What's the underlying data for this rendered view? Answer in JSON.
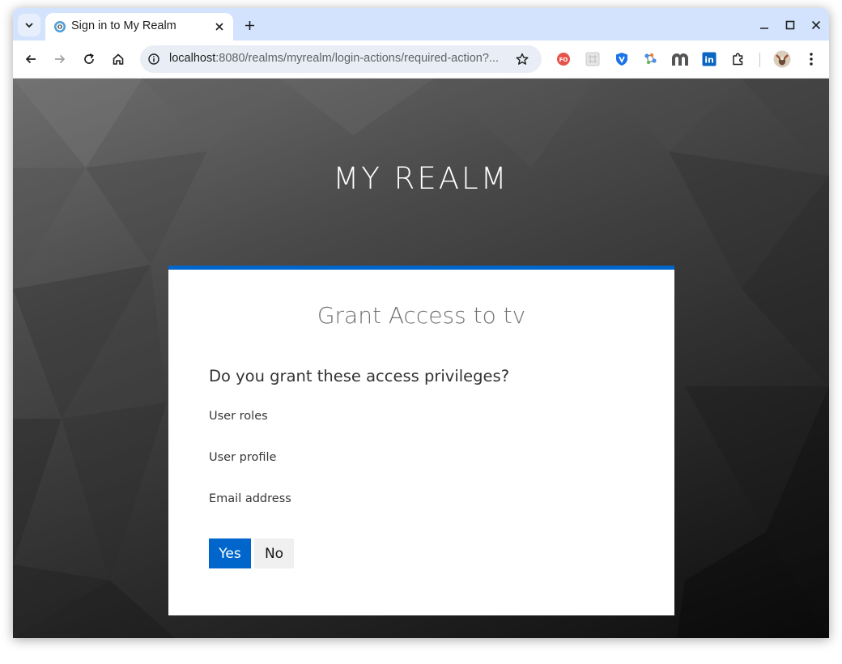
{
  "browser": {
    "tab_title": "Sign in to My Realm",
    "url_host": "localhost",
    "url_rest": ":8080/realms/myrealm/login-actions/required-action?...",
    "icons": {
      "tab_search": "chevron-down-icon",
      "tab_close": "close-icon",
      "new_tab": "plus-icon",
      "minimize": "minimize-icon",
      "maximize": "maximize-icon",
      "close_window": "close-icon",
      "back": "back-arrow-icon",
      "forward": "forward-arrow-icon",
      "reload": "reload-icon",
      "home": "home-icon",
      "site_info": "info-icon",
      "bookmark": "star-icon",
      "extensions": "puzzle-icon",
      "menu": "kebab-menu-icon"
    },
    "extensions": [
      {
        "name": "fo-extension-icon",
        "label": "FO",
        "color": "#e5534b"
      },
      {
        "name": "grid-extension-icon",
        "label": "",
        "color": "#c8c8c8"
      },
      {
        "name": "shield-extension-icon",
        "label": "",
        "color": "#1a73e8"
      },
      {
        "name": "molecule-extension-icon",
        "label": "",
        "color": "#4a8fe7"
      },
      {
        "name": "m-extension-icon",
        "label": "",
        "color": "#555555"
      },
      {
        "name": "linkedin-extension-icon",
        "label": "in",
        "color": "#0a66c2"
      }
    ],
    "colors": {
      "tabstrip": "#d3e3fd",
      "omnibox": "#e9eef6"
    }
  },
  "page": {
    "realm_title": "MY REALM",
    "card": {
      "title": "Grant Access to tv",
      "question": "Do you grant these access privileges?",
      "scopes": [
        "User roles",
        "User profile",
        "Email address"
      ],
      "yes_label": "Yes",
      "no_label": "No"
    },
    "colors": {
      "accent": "#0066cc",
      "card_background": "#ffffff"
    }
  }
}
